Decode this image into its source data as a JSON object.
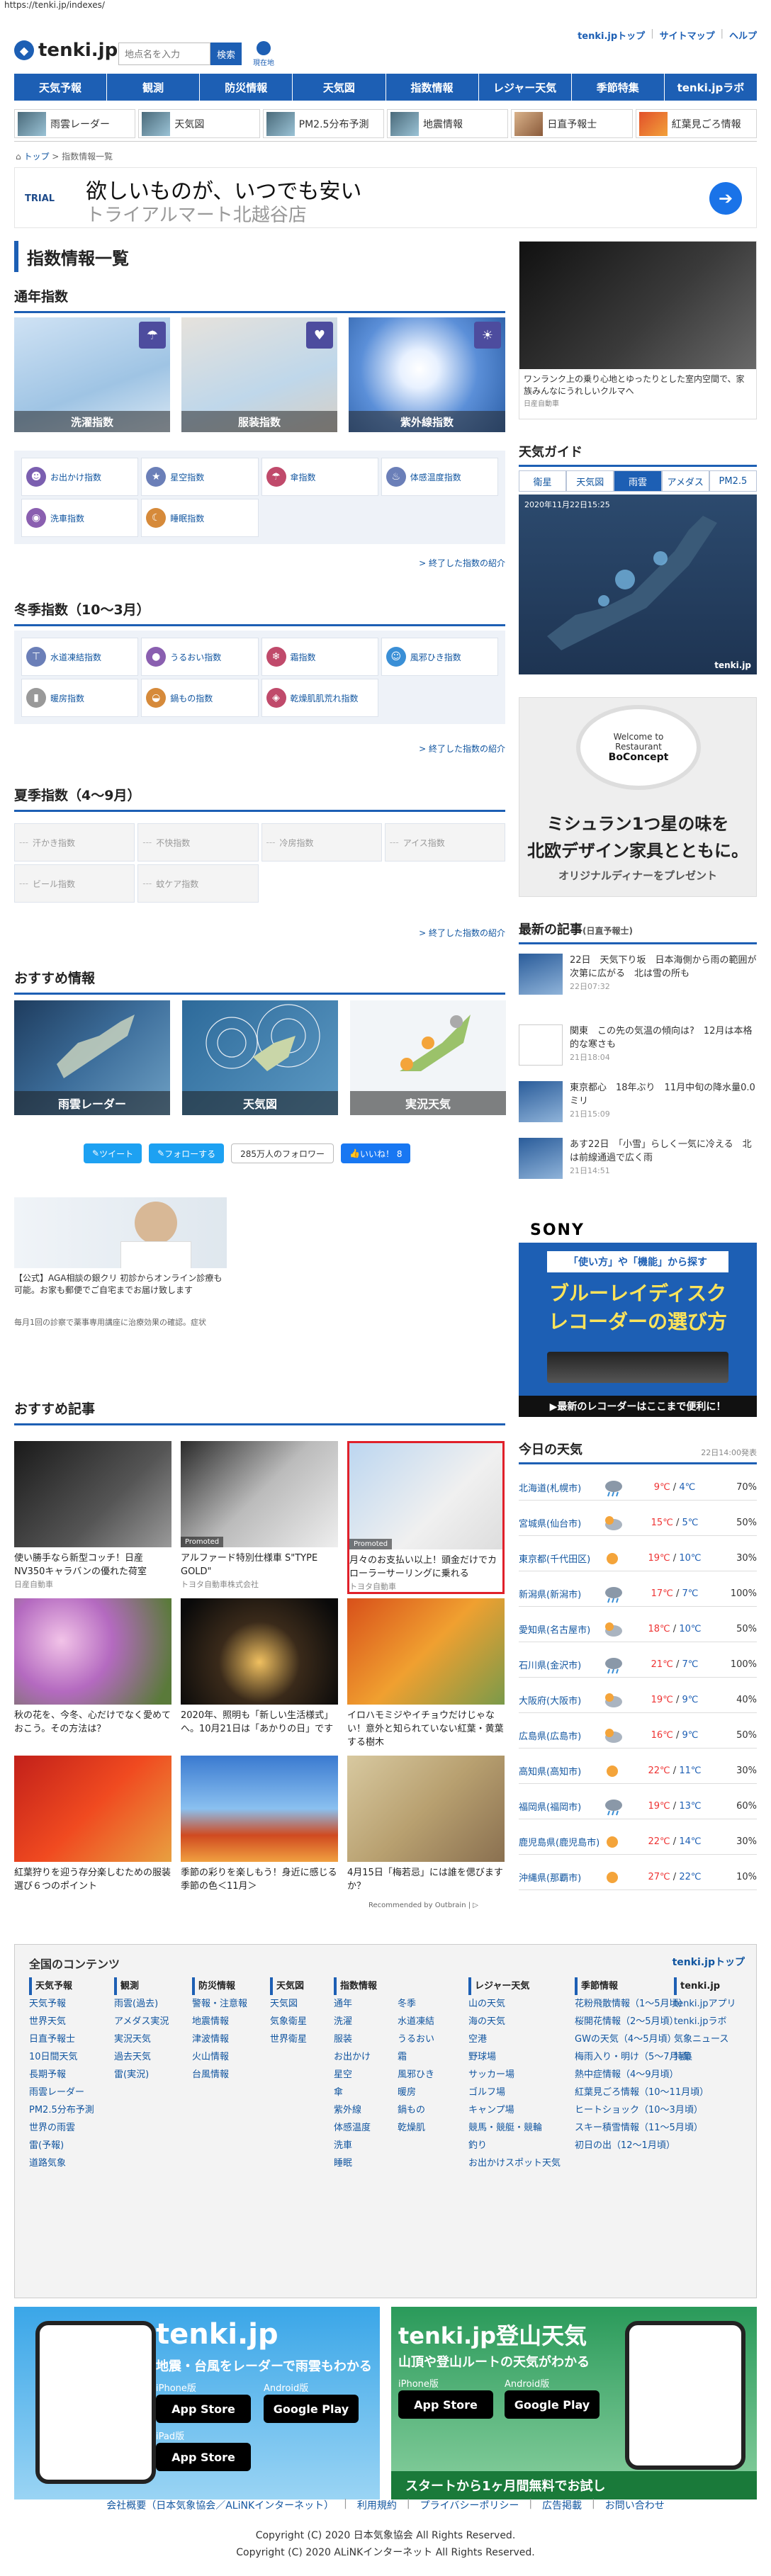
{
  "url": "https://tenki.jp/indexes/",
  "header": {
    "logo": "tenki.jp",
    "search_placeholder": "地点名を入力",
    "search_button": "検索",
    "geo_label": "現在地",
    "top_links": [
      "tenki.jpトップ",
      "サイトマップ",
      "ヘルプ"
    ]
  },
  "gnav": [
    "天気予報",
    "観測",
    "防災情報",
    "天気図",
    "指数情報",
    "レジャー天気",
    "季節特集",
    "tenki.jpラボ"
  ],
  "subnav": [
    "雨雲レーダー",
    "天気図",
    "PM2.5分布予測",
    "地震情報",
    "日直予報士",
    "紅葉見ごろ情報"
  ],
  "breadcrumb": {
    "home": "トップ",
    "current": "指数情報一覧"
  },
  "ad_top": {
    "brand": "TRIAL",
    "line1": "欲しいものが、いつでも安い",
    "line2": "トライアルマート北越谷店"
  },
  "page_title": "指数情報一覧",
  "tsunen": {
    "title": "通年指数",
    "tiles": [
      "洗濯指数",
      "服装指数",
      "紫外線指数"
    ],
    "items": [
      "お出かけ指数",
      "星空指数",
      "傘指数",
      "体感温度指数",
      "洗車指数",
      "睡眠指数"
    ],
    "more": "> 終了した指数の紹介"
  },
  "winter": {
    "title": "冬季指数（10～3月）",
    "items": [
      "水道凍結指数",
      "うるおい指数",
      "霜指数",
      "風邪ひき指数",
      "暖房指数",
      "鍋もの指数",
      "乾燥肌肌荒れ指数"
    ],
    "more": "> 終了した指数の紹介"
  },
  "summer": {
    "title": "夏季指数（4～9月）",
    "items": [
      "汗かき指数",
      "不快指数",
      "冷房指数",
      "アイス指数",
      "ビール指数",
      "蚊ケア指数"
    ],
    "more": "> 終了した指数の紹介"
  },
  "recommend": {
    "title": "おすすめ情報",
    "tiles": [
      "雨雲レーダー",
      "天気図",
      "実況天気"
    ]
  },
  "social": {
    "tweet": "ツイート",
    "follow": "フォローする",
    "followers": "285万人のフォロワー",
    "like": "いいね！ 8"
  },
  "ad_mid": {
    "text": "【公式】AGA相談の銀クリ 初診からオンライン診療も可能。お家も郵便でご自宅までお届け致します",
    "sub": "毎月1回の診察で薬事専用講座に治療効果の確認。症状"
  },
  "articles": {
    "title": "おすすめ記事",
    "items": [
      {
        "text": "使い勝手なら新型コッチ！日産NV350キャラバンの優れた荷室",
        "src": "日産自動車"
      },
      {
        "text": "アルファード特別仕様車 S\"TYPE GOLD\"",
        "src": "トヨタ自動車株式会社",
        "promo": "Promoted"
      },
      {
        "text": "月々のお支払い以上！頭金だけでカローラーサーリングに乗れる",
        "src": "トヨタ自動車",
        "promo": "Promoted"
      },
      {
        "text": "秋の花を、今冬、心だけでなく愛めておこう。その方法は？",
        "src": ""
      },
      {
        "text": "2020年、照明も「新しい生活様式」へ。10月21日は「あかりの日」です",
        "src": ""
      },
      {
        "text": "イロハモミジやイチョウだけじゃない！意外と知られていない紅葉・黄葉する樹木",
        "src": ""
      },
      {
        "text": "紅葉狩りを迎う存分楽しむための服装選び６つのポイント",
        "src": ""
      },
      {
        "text": "季節の彩りを楽しもう！身近に感じる季節の色＜11月＞",
        "src": ""
      },
      {
        "text": "4月15日「梅若忌」には誰を偲びますか？",
        "src": ""
      }
    ],
    "promo_label": "Promoted",
    "recommended_by": "Recommended by Outbrain | ▷"
  },
  "side": {
    "ad1_caption": "ワンランク上の乗り心地とゆったりとした室内空間で、家族みんなにうれしいクルマへ",
    "ad1_sub": "日産自動車",
    "guide_title": "天気ガイド",
    "guide_tabs": [
      "衛星",
      "天気図",
      "雨雲",
      "アメダス",
      "PM2.5"
    ],
    "guide_time": "2020年11月22日15:25",
    "guide_logo": "tenki.jp",
    "ad2_line1": "Welcome to Restaurant",
    "ad2_brand": "BoConcept",
    "ad2_line2": "ミシュラン1つ星の味を",
    "ad2_line3": "北欧デザイン家具とともに。",
    "ad2_line4": "オリジナルディナーをプレゼント",
    "latest_title": "最新の記事",
    "latest_sub": "(日直予報士)",
    "latest": [
      {
        "text": "22日　天気下り坂　日本海側から雨の範囲が次第に広がる　北は雪の所も",
        "time": "22日07:32"
      },
      {
        "text": "関東　この先の気温の傾向は?　12月は本格的な寒さも",
        "time": "21日18:04"
      },
      {
        "text": "東京都心　18年ぶり　11月中旬の降水量0.0ミリ",
        "time": "21日15:09"
      },
      {
        "text": "あす22日　「小雪」らしく一気に冷える　北は前線通過で広く雨",
        "time": "21日14:51"
      }
    ],
    "sony_brand": "SONY",
    "sony_tag": "「使い方」や「機能」から探す",
    "sony_line1": "ブルーレイディスク",
    "sony_line2": "レコーダーの選び方",
    "sony_foot": "▶最新のレコーダーはここまで便利に！",
    "today_title": "今日の天気",
    "today_time": "22日14:00発表",
    "cities": [
      {
        "city": "北海道(札幌市)",
        "high": "9℃",
        "low": "4℃",
        "pop": "70%",
        "wx": "rain"
      },
      {
        "city": "宮城県(仙台市)",
        "high": "15℃",
        "low": "5℃",
        "pop": "50%",
        "wx": "cloud"
      },
      {
        "city": "東京都(千代田区)",
        "high": "19℃",
        "low": "10℃",
        "pop": "30%",
        "wx": "sun"
      },
      {
        "city": "新潟県(新潟市)",
        "high": "17℃",
        "low": "7℃",
        "pop": "100%",
        "wx": "rain"
      },
      {
        "city": "愛知県(名古屋市)",
        "high": "18℃",
        "low": "10℃",
        "pop": "50%",
        "wx": "cloud"
      },
      {
        "city": "石川県(金沢市)",
        "high": "21℃",
        "low": "7℃",
        "pop": "100%",
        "wx": "rain"
      },
      {
        "city": "大阪府(大阪市)",
        "high": "19℃",
        "low": "9℃",
        "pop": "40%",
        "wx": "cloud"
      },
      {
        "city": "広島県(広島市)",
        "high": "16℃",
        "low": "9℃",
        "pop": "50%",
        "wx": "cloud"
      },
      {
        "city": "高知県(高知市)",
        "high": "22℃",
        "low": "11℃",
        "pop": "30%",
        "wx": "sun"
      },
      {
        "city": "福岡県(福岡市)",
        "high": "19℃",
        "low": "13℃",
        "pop": "60%",
        "wx": "rain"
      },
      {
        "city": "鹿児島県(鹿児島市)",
        "high": "22℃",
        "low": "14℃",
        "pop": "30%",
        "wx": "sun"
      },
      {
        "city": "沖縄県(那覇市)",
        "high": "27℃",
        "low": "22℃",
        "pop": "10%",
        "wx": "sun"
      }
    ]
  },
  "footer": {
    "title": "全国のコンテンツ",
    "top_link": "tenki.jpトップ",
    "cols": [
      {
        "hd": "天気予報",
        "items": [
          "天気予報",
          "世界天気",
          "日直予報士",
          "10日間天気",
          "長期予報",
          "雨雲レーダー",
          "PM2.5分布予測",
          "世界の雨雲",
          "雷(予報)",
          "道路気象"
        ]
      },
      {
        "hd": "観測",
        "items": [
          "雨雲(過去)",
          "アメダス実況",
          "実況天気",
          "過去天気",
          "雷(実況)"
        ]
      },
      {
        "hd": "防災情報",
        "items": [
          "警報・注意報",
          "地震情報",
          "津波情報",
          "火山情報",
          "台風情報"
        ]
      },
      {
        "hd": "天気図",
        "items": [
          "天気図",
          "気象衛星",
          "世界衛星"
        ]
      },
      {
        "hd": "指数情報",
        "items": [
          "通年",
          "洗濯",
          "服装",
          "お出かけ",
          "星空",
          "傘",
          "紫外線",
          "体感温度",
          "洗車",
          "睡眠"
        ]
      },
      {
        "hd": "",
        "items": [
          "冬季",
          "水道凍結",
          "うるおい",
          "霜",
          "風邪ひき",
          "暖房",
          "鍋もの",
          "乾燥肌"
        ]
      },
      {
        "hd": "レジャー天気",
        "items": [
          "山の天気",
          "海の天気",
          "空港",
          "野球場",
          "サッカー場",
          "ゴルフ場",
          "キャンプ場",
          "競馬・競艇・競輪",
          "釣り",
          "お出かけスポット天気"
        ]
      },
      {
        "hd": "季節情報",
        "items": [
          "花粉飛散情報（1～5月頃）",
          "桜開花情報（2～5月頃）",
          "GWの天気（4～5月頃）",
          "梅雨入り・明け（5～7月頃）",
          "熱中症情報（4～9月頃）",
          "紅葉見ごろ情報（10～11月頃）",
          "ヒートショック（10～3月頃）",
          "スキー積雪情報（11～5月頃）",
          "初日の出（12～1月頃）"
        ]
      },
      {
        "hd": "tenki.jp",
        "items": [
          "tenki.jpアプリ",
          "tenki.jpラボ",
          "気象ニュース",
          "特集"
        ]
      }
    ]
  },
  "banners": {
    "left_logo": "tenki.jp",
    "left_tag": "地震・台風をレーダーで雨雲もわかる",
    "right_logo": "tenki.jp登山天気",
    "right_tag": "山頂や登山ルートの天気がわかる",
    "iphone": "iPhone版",
    "android": "Android版",
    "ipad": "iPad版",
    "appstore": "App Store",
    "googleplay": "Google Play",
    "right_foot": "スタートから1ヶ月間無料でお試し"
  },
  "foot_links": [
    "会社概要（日本気象協会／ALiNKインターネット）",
    "利用規約",
    "プライバシーポリシー",
    "広告掲載",
    "お問い合わせ"
  ],
  "copyright1": "Copyright (C) 2020 日本気象協会 All Rights Reserved.",
  "copyright2": "Copyright (C) 2020 ALiNKインターネット All Rights Reserved."
}
